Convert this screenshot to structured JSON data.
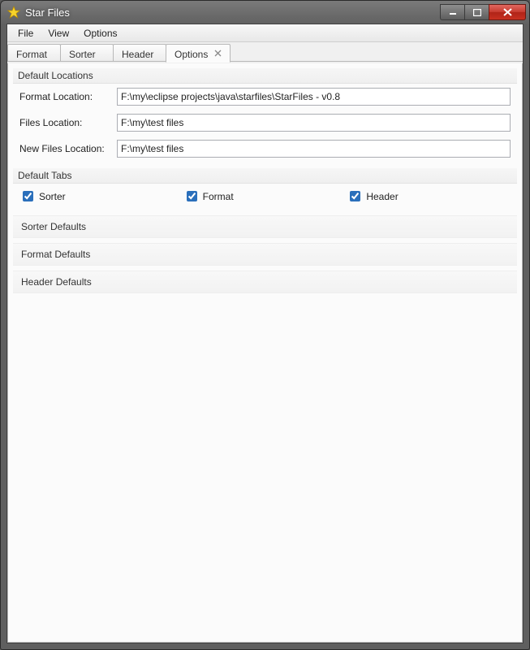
{
  "window": {
    "title": "Star Files"
  },
  "menubar": {
    "items": [
      "File",
      "View",
      "Options"
    ]
  },
  "tabs": {
    "items": [
      {
        "label": "Format"
      },
      {
        "label": "Sorter"
      },
      {
        "label": "Header"
      },
      {
        "label": "Options"
      }
    ],
    "active_index": 3
  },
  "options_panel": {
    "default_locations": {
      "title": "Default Locations",
      "rows": [
        {
          "label": "Format Location:",
          "value": "F:\\my\\eclipse projects\\java\\starfiles\\StarFiles - v0.8"
        },
        {
          "label": "Files Location:",
          "value": "F:\\my\\test files"
        },
        {
          "label": "New Files Location:",
          "value": "F:\\my\\test files"
        }
      ]
    },
    "default_tabs": {
      "title": "Default Tabs",
      "checks": [
        {
          "label": "Sorter",
          "checked": true
        },
        {
          "label": "Format",
          "checked": true
        },
        {
          "label": "Header",
          "checked": true
        }
      ]
    },
    "sections": [
      "Sorter Defaults",
      "Format Defaults",
      "Header Defaults"
    ]
  }
}
